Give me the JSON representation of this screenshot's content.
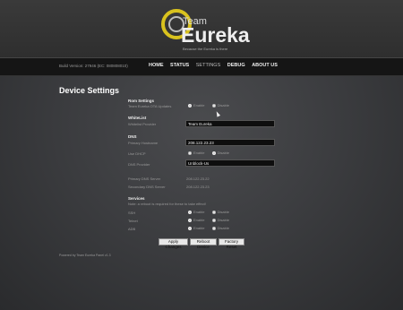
{
  "header": {
    "logo_team": "Team",
    "logo_name": "Eureka",
    "logo_tagline": "Because the Eureka is there"
  },
  "nav": {
    "build_version": "Build Version: 27946 (EC: 080808010)",
    "links": [
      "HOME",
      "STATUS",
      "SETTINGS",
      "DEBUG",
      "ABOUT US"
    ],
    "active": "SETTINGS"
  },
  "page": {
    "title": "Device Settings"
  },
  "rom": {
    "heading": "Rom Settings",
    "ota_label": "Team Eureka OTA Updates",
    "enabled": "Enable",
    "disabled": "Disable"
  },
  "whitelist": {
    "heading": "WhiteList",
    "provider_label": "Whitelist Provider",
    "provider_value": "Team Eureka"
  },
  "dns": {
    "heading": "DNS",
    "dns_label": "Primary Hostname",
    "dns_value": "208.122.23.23",
    "dhcp_label": "Use DHCP",
    "enabled": "Enable",
    "disabled": "Disable",
    "provider_label": "DNS Provider",
    "provider_value": "Unblock-Us",
    "primary_label": "Primary DNS Server",
    "primary_value": "208.122.23.22",
    "secondary_label": "Secondary DNS Server",
    "secondary_value": "208.122.23.23"
  },
  "services": {
    "heading": "Services",
    "note": "Note: a reboot is required for these to take effect!",
    "items": [
      {
        "label": "SSH",
        "enabled": "Enable",
        "disabled": "Disable"
      },
      {
        "label": "Telnet",
        "enabled": "Enable",
        "disabled": "Disable"
      },
      {
        "label": "ADB",
        "enabled": "Enable",
        "disabled": "Disable"
      }
    ]
  },
  "buttons": {
    "apply": "Apply Changes",
    "reboot": "Reboot Device",
    "factory": "Factory Reset"
  },
  "footer": {
    "text": "Powered by Team Eureka Panel v1.3"
  }
}
